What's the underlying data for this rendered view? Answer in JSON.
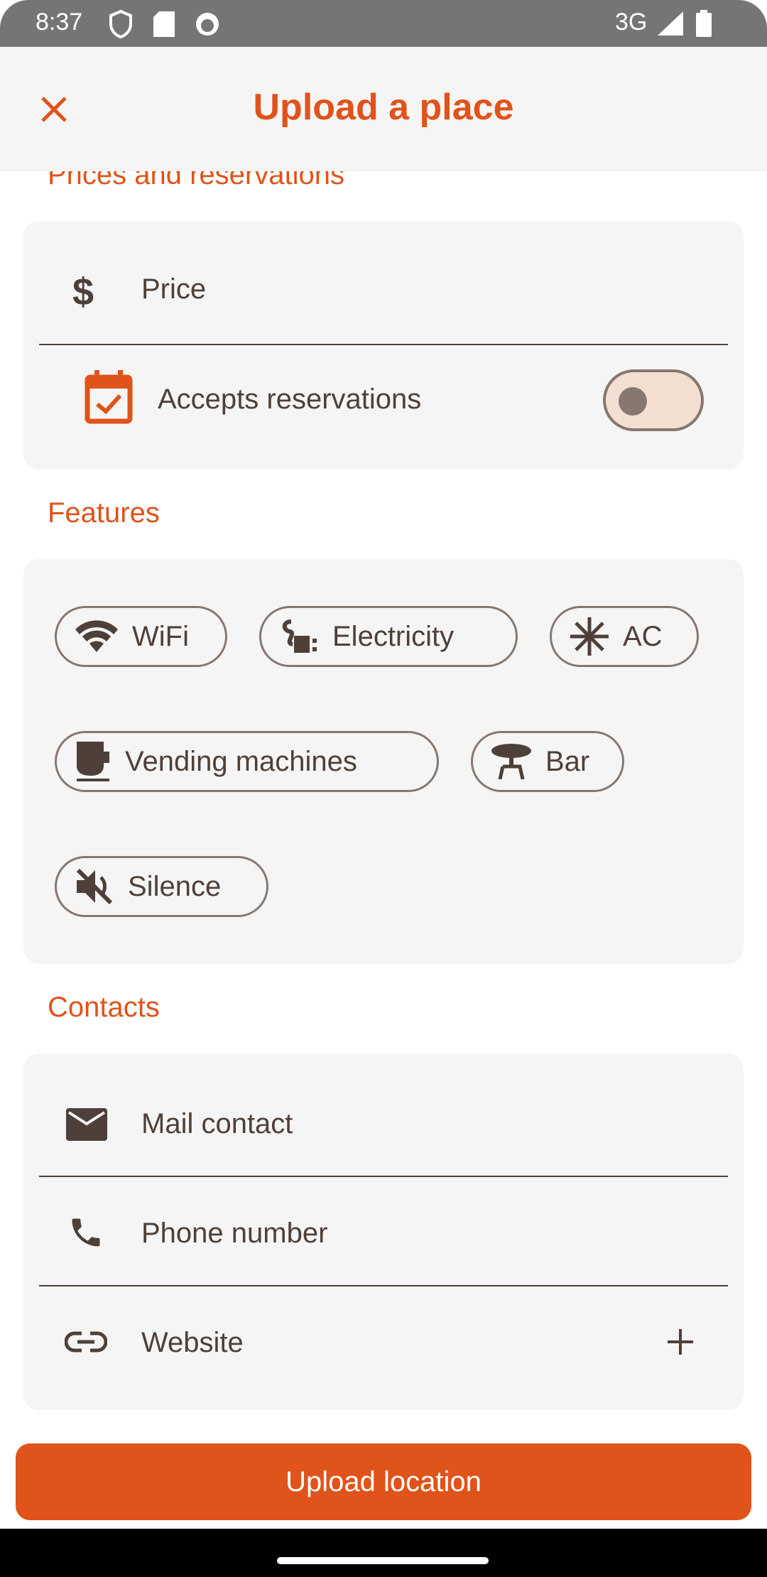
{
  "status_bar": {
    "time": "8:37",
    "network": "3G"
  },
  "app_bar": {
    "title": "Upload a place"
  },
  "sections": {
    "prices": "Prices and reservations",
    "features": "Features",
    "contacts": "Contacts"
  },
  "prices": {
    "price_placeholder": "Price",
    "reservations_label": "Accepts reservations",
    "reservations_enabled": false
  },
  "features": [
    "WiFi",
    "Electricity",
    "AC",
    "Vending machines",
    "Bar",
    "Silence"
  ],
  "contacts": {
    "mail_placeholder": "Mail contact",
    "phone_placeholder": "Phone number",
    "website_placeholder": "Website"
  },
  "upload_button": "Upload location",
  "colors": {
    "accent": "#e0531a",
    "text": "#4e4039",
    "card": "#f5f5f5"
  }
}
